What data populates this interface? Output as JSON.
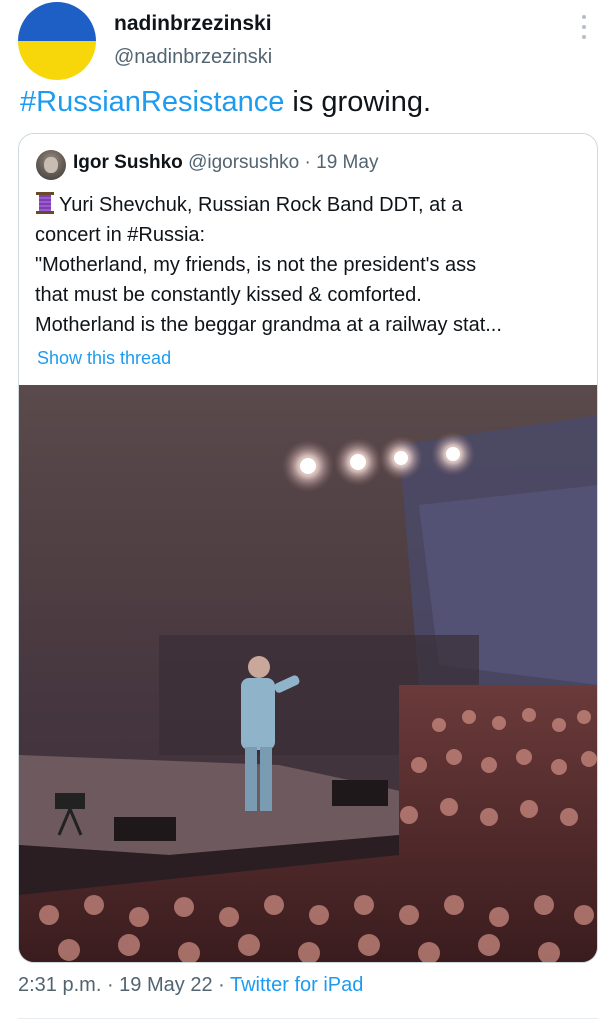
{
  "author": {
    "display_name": "nadinbrzezinski",
    "handle": "@nadinbrzezinski"
  },
  "tweet": {
    "hashtag": "#RussianResistance",
    "text_rest": " is growing."
  },
  "quoted_tweet": {
    "name": "Igor Sushko",
    "handle": "@igorsushko",
    "separator": " · ",
    "date": "19 May",
    "spool_icon": "spool-of-thread-emoji",
    "lines": [
      "Yuri Shevchuk, Russian Rock Band DDT, at a",
      "concert in #Russia:",
      "\"Motherland, my friends, is not the president's ass",
      "that must be constantly kissed & comforted.",
      "Motherland is the beggar grandma at a railway stat..."
    ],
    "show_thread": "Show this thread"
  },
  "footer": {
    "time": "2:31 p.m.",
    "sep1": " · ",
    "date": "19 May 22",
    "sep2": " · ",
    "source": "Twitter for iPad"
  },
  "colors": {
    "link": "#1d9bf0",
    "secondary_text": "#536471",
    "flag_blue": "#1d5fc4",
    "flag_yellow": "#f8d70a"
  }
}
